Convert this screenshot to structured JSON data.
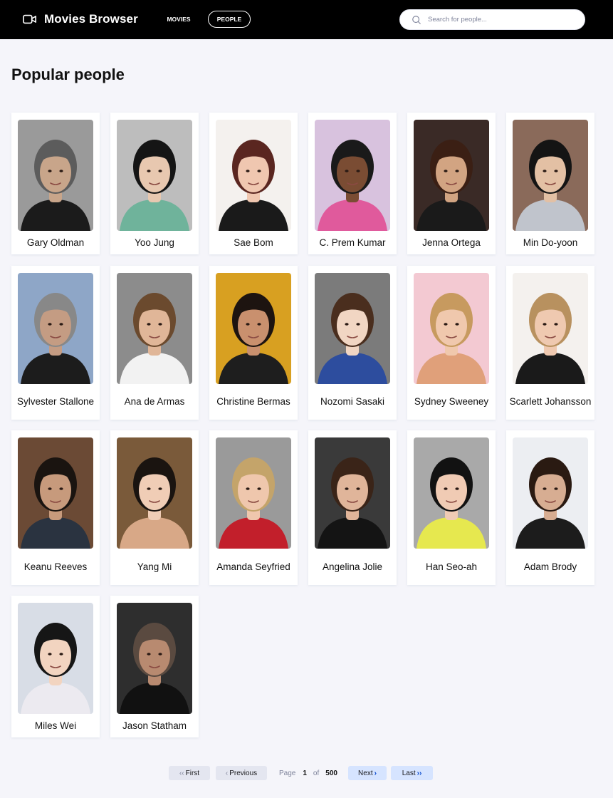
{
  "app": {
    "title": "Movies Browser",
    "logo_icon": "video-camera-icon"
  },
  "nav": {
    "movies_label": "MOVIES",
    "people_label": "PEOPLE",
    "active": "people"
  },
  "search": {
    "placeholder": "Search for people...",
    "value": "",
    "icon": "search-icon"
  },
  "page": {
    "title": "Popular people"
  },
  "people": [
    {
      "name": "Gary Oldman",
      "bg": "#9a9a9a",
      "skin": "#c8a58a",
      "hair": "#5c5c5c",
      "cloth": "#1b1b1b"
    },
    {
      "name": "Yoo Jung",
      "bg": "#bdbdbd",
      "skin": "#e8c8b0",
      "hair": "#151515",
      "cloth": "#6fb39b"
    },
    {
      "name": "Sae Bom",
      "bg": "#f4f1ee",
      "skin": "#f0c7b0",
      "hair": "#5a2620",
      "cloth": "#1a1a1a"
    },
    {
      "name": "C. Prem Kumar",
      "bg": "#d8c2de",
      "skin": "#7a4c33",
      "hair": "#1a1a1a",
      "cloth": "#e05a9c"
    },
    {
      "name": "Jenna Ortega",
      "bg": "#3a2a26",
      "skin": "#d2a482",
      "hair": "#3b1f14",
      "cloth": "#1a1a1a"
    },
    {
      "name": "Min Do-yoon",
      "bg": "#8a6a5a",
      "skin": "#e3c0a4",
      "hair": "#141414",
      "cloth": "#c0c4cc"
    },
    {
      "name": "Sylvester Stallone",
      "bg": "#8ea6c7",
      "skin": "#c49c83",
      "hair": "#888888",
      "cloth": "#1c1c1c"
    },
    {
      "name": "Ana de Armas",
      "bg": "#8c8c8c",
      "skin": "#e0b698",
      "hair": "#6b4a2e",
      "cloth": "#f2f2f2"
    },
    {
      "name": "Christine Bermas",
      "bg": "#d8a021",
      "skin": "#c9906e",
      "hair": "#1d1410",
      "cloth": "#1e1e1e"
    },
    {
      "name": "Nozomi Sasaki",
      "bg": "#7b7b7b",
      "skin": "#f1d6c3",
      "hair": "#4a2e1e",
      "cloth": "#2d4d9e"
    },
    {
      "name": "Sydney Sweeney",
      "bg": "#f3c9d2",
      "skin": "#f0c8ad",
      "hair": "#c79a5f",
      "cloth": "#e0a07a"
    },
    {
      "name": "Scarlett Johansson",
      "bg": "#f4f1ee",
      "skin": "#efc9b0",
      "hair": "#b8915f",
      "cloth": "#1a1a1a"
    },
    {
      "name": "Keanu Reeves",
      "bg": "#6b4a35",
      "skin": "#c79a7c",
      "hair": "#1a1410",
      "cloth": "#2a3340"
    },
    {
      "name": "Yang Mi",
      "bg": "#7a5a3a",
      "skin": "#f0cdb6",
      "hair": "#1a1410",
      "cloth": "#d8a887"
    },
    {
      "name": "Amanda Seyfried",
      "bg": "#9a9a9a",
      "skin": "#efc7ad",
      "hair": "#c4a46a",
      "cloth": "#c21f2b"
    },
    {
      "name": "Angelina Jolie",
      "bg": "#3a3a3a",
      "skin": "#e0b59a",
      "hair": "#3a2418",
      "cloth": "#141414"
    },
    {
      "name": "Han Seo-ah",
      "bg": "#a9a9a9",
      "skin": "#f0cbb4",
      "hair": "#121212",
      "cloth": "#e6e84f"
    },
    {
      "name": "Adam Brody",
      "bg": "#eceef2",
      "skin": "#d7ad92",
      "hair": "#2a1a12",
      "cloth": "#1c1c1c"
    },
    {
      "name": "Miles Wei",
      "bg": "#d8dde6",
      "skin": "#f2d4c0",
      "hair": "#161616",
      "cloth": "#eceaf0"
    },
    {
      "name": "Jason Statham",
      "bg": "#2e2e2e",
      "skin": "#b88a70",
      "hair": "#5a4a40",
      "cloth": "#111111"
    }
  ],
  "pagination": {
    "first_label": "First",
    "previous_label": "Previous",
    "page_label": "Page",
    "current_page": "1",
    "of_label": "of",
    "total_pages": "500",
    "next_label": "Next",
    "last_label": "Last"
  },
  "colors": {
    "background": "#f5f5fa",
    "header": "#000000",
    "button_disabled": "#e4e6f0",
    "button_active": "#d6e4ff",
    "accent": "#0044cc"
  }
}
